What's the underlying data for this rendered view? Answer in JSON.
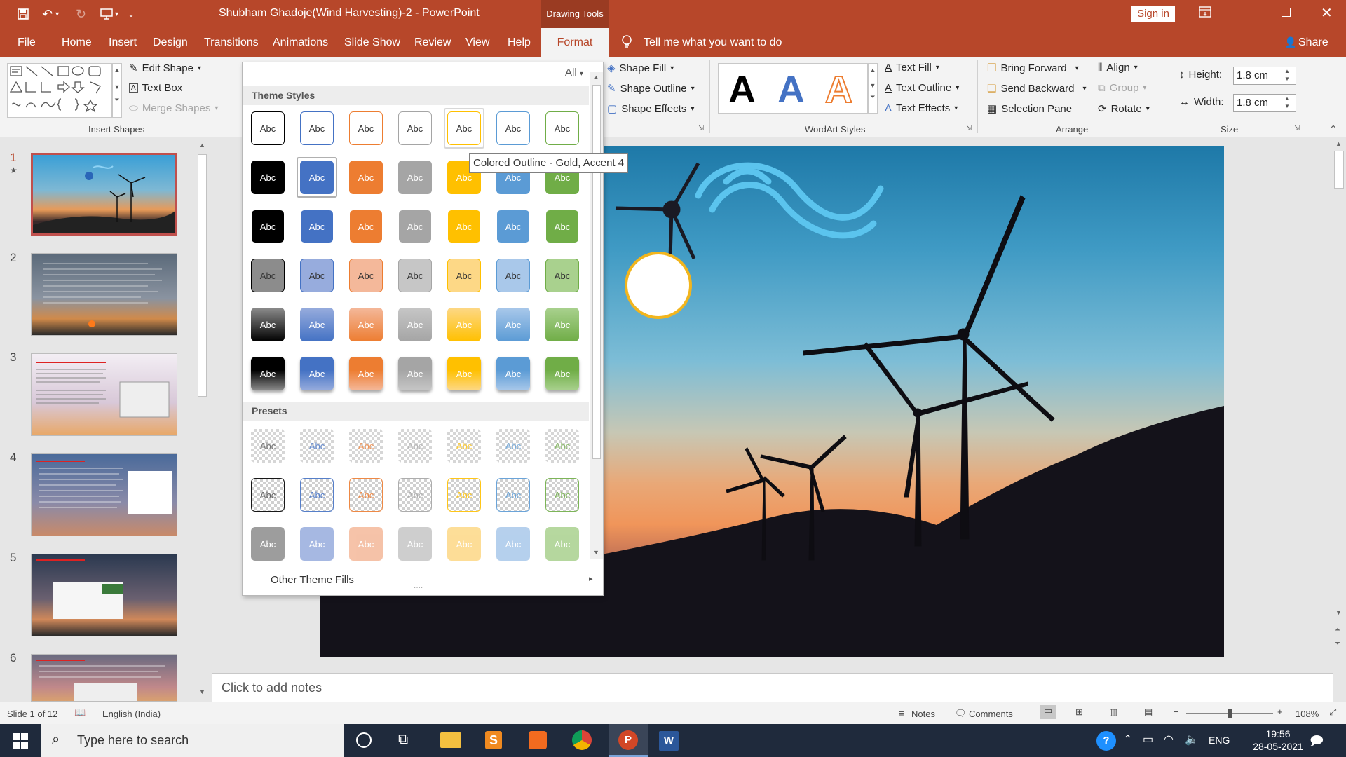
{
  "window": {
    "title": "Shubham Ghadoje(Wind Harvesting)-2  -  PowerPoint",
    "context_tab": "Drawing Tools",
    "sign_in": "Sign in"
  },
  "tabs": [
    "File",
    "Home",
    "Insert",
    "Design",
    "Transitions",
    "Animations",
    "Slide Show",
    "Review",
    "View",
    "Help",
    "Format"
  ],
  "tell_me": "Tell me what you want to do",
  "share": "Share",
  "ribbon": {
    "insert_shapes": {
      "edit_shape": "Edit Shape",
      "text_box": "Text Box",
      "merge_shapes": "Merge Shapes",
      "label": "Insert Shapes"
    },
    "shape_styles": {
      "shape_fill": "Shape Fill",
      "shape_outline": "Shape Outline",
      "shape_effects": "Shape Effects"
    },
    "wordart": {
      "sample": "A",
      "text_fill": "Text Fill",
      "text_outline": "Text Outline",
      "text_effects": "Text Effects",
      "label": "WordArt Styles"
    },
    "arrange": {
      "bring_forward": "Bring Forward",
      "send_backward": "Send Backward",
      "selection_pane": "Selection Pane",
      "align": "Align",
      "group": "Group",
      "rotate": "Rotate",
      "label": "Arrange"
    },
    "size": {
      "height_label": "Height:",
      "height_value": "1.8 cm",
      "width_label": "Width:",
      "width_value": "1.8 cm",
      "label": "Size"
    }
  },
  "gallery": {
    "filter": "All",
    "theme_header": "Theme Styles",
    "presets_header": "Presets",
    "swatch_text": "Abc",
    "other_fills": "Other Theme Fills",
    "tooltip": "Colored Outline - Gold, Accent 4",
    "colors": [
      "#000000",
      "#4472c4",
      "#ed7d31",
      "#a5a5a5",
      "#ffc000",
      "#5b9bd5",
      "#70ad47"
    ],
    "light_colors": [
      "#8c8c8c",
      "#97acdd",
      "#f4b89a",
      "#c6c6c6",
      "#fdd886",
      "#a9c8ea",
      "#a9d18e"
    ]
  },
  "slides": [
    {
      "num": "1",
      "star": "★"
    },
    {
      "num": "2"
    },
    {
      "num": "3"
    },
    {
      "num": "4"
    },
    {
      "num": "5"
    },
    {
      "num": "6"
    }
  ],
  "notes_placeholder": "Click to add notes",
  "status": {
    "slide": "Slide 1 of 12",
    "language": "English (India)",
    "notes": "Notes",
    "comments": "Comments",
    "zoom": "108%"
  },
  "taskbar": {
    "search": "Type here to search",
    "lang": "ENG",
    "time": "19:56",
    "date": "28-05-2021"
  }
}
